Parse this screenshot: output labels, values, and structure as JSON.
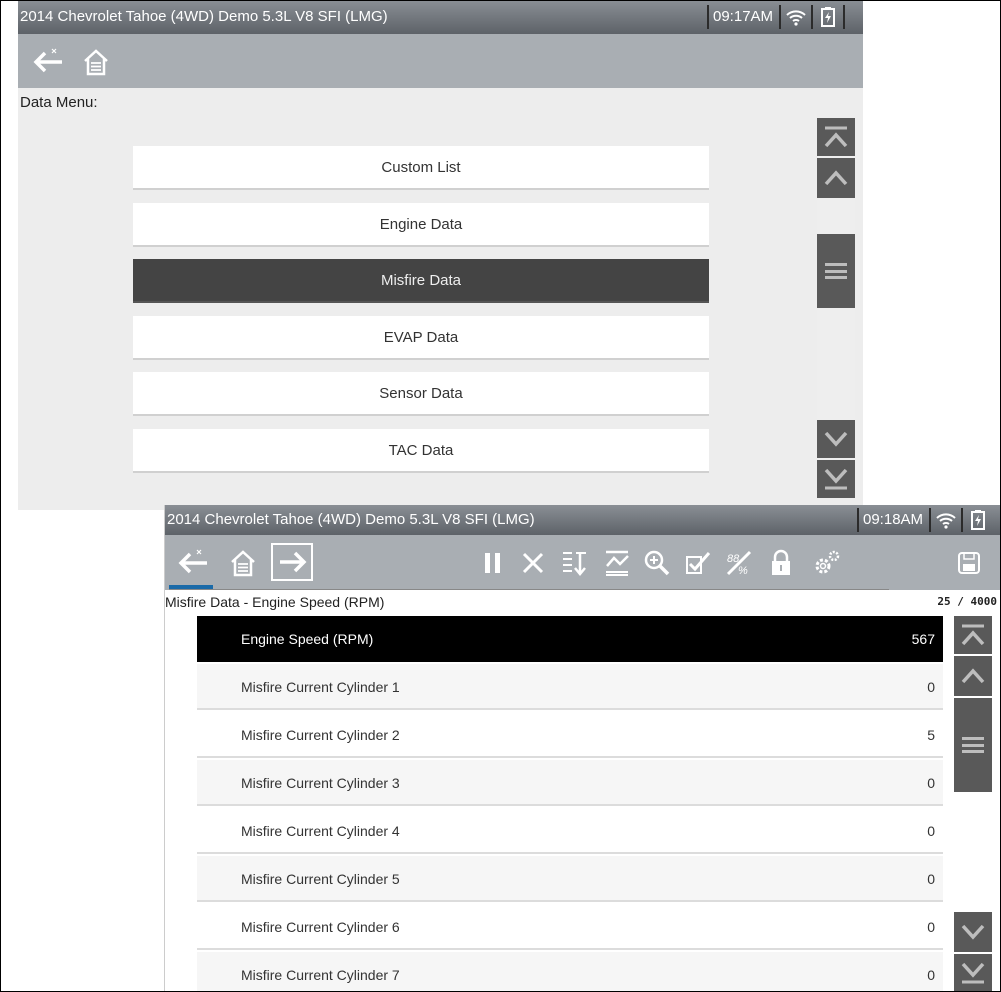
{
  "screen1": {
    "title": "2014 Chevrolet Tahoe (4WD) Demo 5.3L V8 SFI (LMG)",
    "time": "09:17AM",
    "menu_label": "Data Menu:",
    "menu_items": [
      {
        "label": "Custom List"
      },
      {
        "label": "Engine Data"
      },
      {
        "label": "Misfire Data",
        "selected": true
      },
      {
        "label": "EVAP Data"
      },
      {
        "label": "Sensor Data"
      },
      {
        "label": "TAC Data"
      }
    ]
  },
  "screen2": {
    "title": "2014 Chevrolet Tahoe (4WD) Demo 5.3L V8 SFI (LMG)",
    "time": "09:18AM",
    "data_label": "Misfire Data - Engine Speed (RPM)",
    "counter": "25 / 4000",
    "rows": [
      {
        "name": "Engine Speed (RPM)",
        "value": "567",
        "selected": true
      },
      {
        "name": "Misfire Current Cylinder 1",
        "value": "0"
      },
      {
        "name": "Misfire Current Cylinder 2",
        "value": "5"
      },
      {
        "name": "Misfire Current Cylinder 3",
        "value": "0"
      },
      {
        "name": "Misfire Current Cylinder 4",
        "value": "0"
      },
      {
        "name": "Misfire Current Cylinder 5",
        "value": "0"
      },
      {
        "name": "Misfire Current Cylinder 6",
        "value": "0"
      },
      {
        "name": "Misfire Current Cylinder 7",
        "value": "0"
      }
    ]
  },
  "icons": {
    "back": "back-arrow-icon",
    "home": "home-icon",
    "forward": "forward-arrow-icon",
    "pause": "pause-icon",
    "clear": "clear-icon",
    "sort": "sort-icon",
    "graph": "graph-view-icon",
    "zoom": "zoom-icon",
    "check": "check-icon",
    "units": "units-icon",
    "lock": "lock-icon",
    "settings": "settings-icon",
    "save": "save-icon",
    "wifi": "wifi-icon",
    "battery": "battery-icon"
  },
  "colors": {
    "titlebar": "#6f747a",
    "toolbar": "#a9aeb3",
    "selected_menu": "#444444",
    "selected_row": "#000000",
    "scroll_button": "#595959",
    "tab_indicator": "#1a6aa8"
  }
}
